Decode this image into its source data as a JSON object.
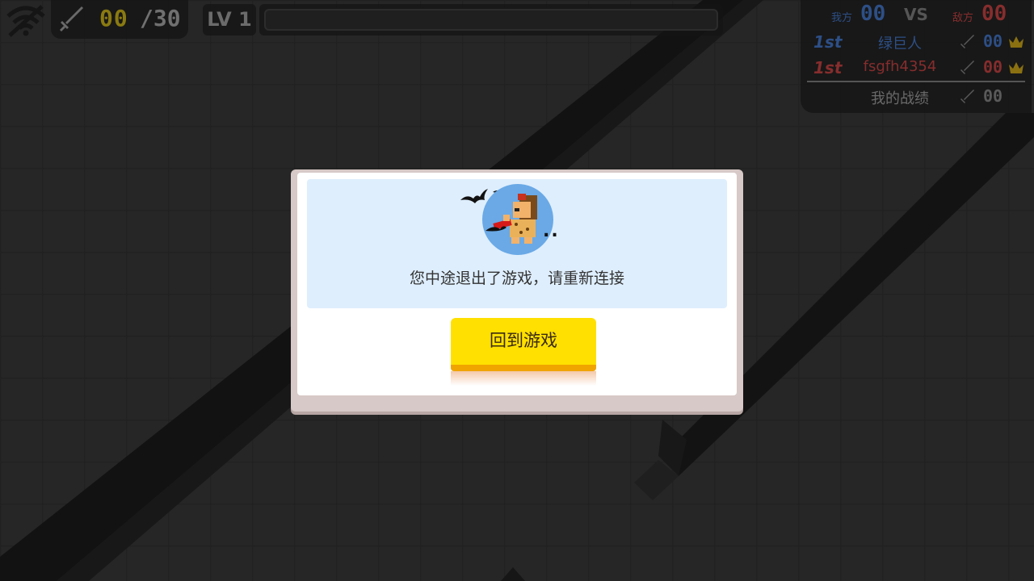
{
  "hud": {
    "kills_current": "00",
    "kills_total": "/30",
    "level_label": "LV 1",
    "xp_progress": 0
  },
  "scoreboard": {
    "our_label": "我方",
    "our_score": "00",
    "vs_label": "VS",
    "enemy_label": "敌方",
    "enemy_score": "00",
    "players": [
      {
        "rank": "1st",
        "name": "绿巨人",
        "kills": "00",
        "team_color": "#3a6fb8"
      },
      {
        "rank": "1st",
        "name": "fsgfh4354",
        "kills": "00",
        "team_color": "#b83a3a"
      }
    ],
    "my_record_label": "我的战绩",
    "my_kills": "00"
  },
  "dialog": {
    "message": "您中途退出了游戏，请重新连接",
    "ellipsis": "..",
    "return_button_label": "回到游戏"
  },
  "colors": {
    "button_yellow": "#ffe000",
    "button_orange": "#f0a400",
    "message_bg": "#deeefd",
    "our_blue": "#3a6fb8",
    "enemy_red": "#b83a3a"
  }
}
